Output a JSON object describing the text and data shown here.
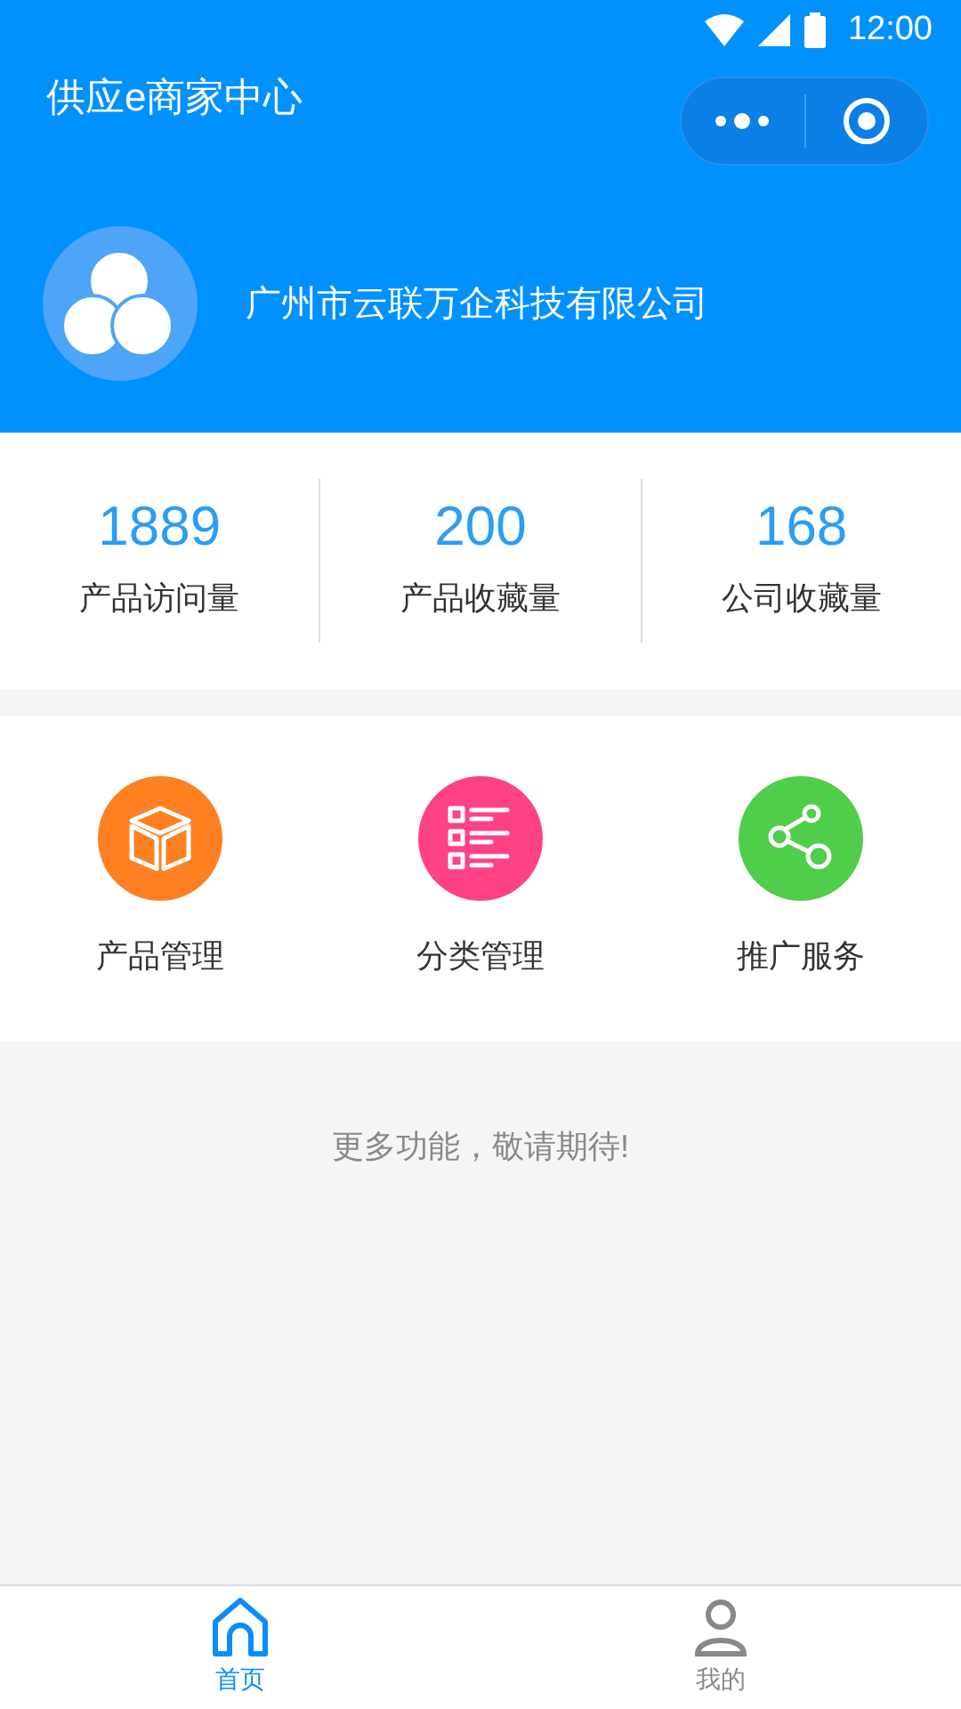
{
  "status_bar": {
    "time": "12:00"
  },
  "header": {
    "title": "供应e商家中心",
    "company": "广州市云联万企科技有限公司"
  },
  "stats": [
    {
      "value": "1889",
      "label": "产品访问量"
    },
    {
      "value": "200",
      "label": "产品收藏量"
    },
    {
      "value": "168",
      "label": "公司收藏量"
    }
  ],
  "functions": [
    {
      "kind": "box",
      "label": "产品管理",
      "color": "#ff8022"
    },
    {
      "kind": "list",
      "label": "分类管理",
      "color": "#ff4186"
    },
    {
      "kind": "share",
      "label": "推广服务",
      "color": "#50cd4b"
    }
  ],
  "notice": "更多功能，敬请期待!",
  "tab_bar": [
    {
      "kind": "home",
      "label": "首页",
      "selected": true
    },
    {
      "kind": "person",
      "label": "我的",
      "selected": false
    }
  ]
}
